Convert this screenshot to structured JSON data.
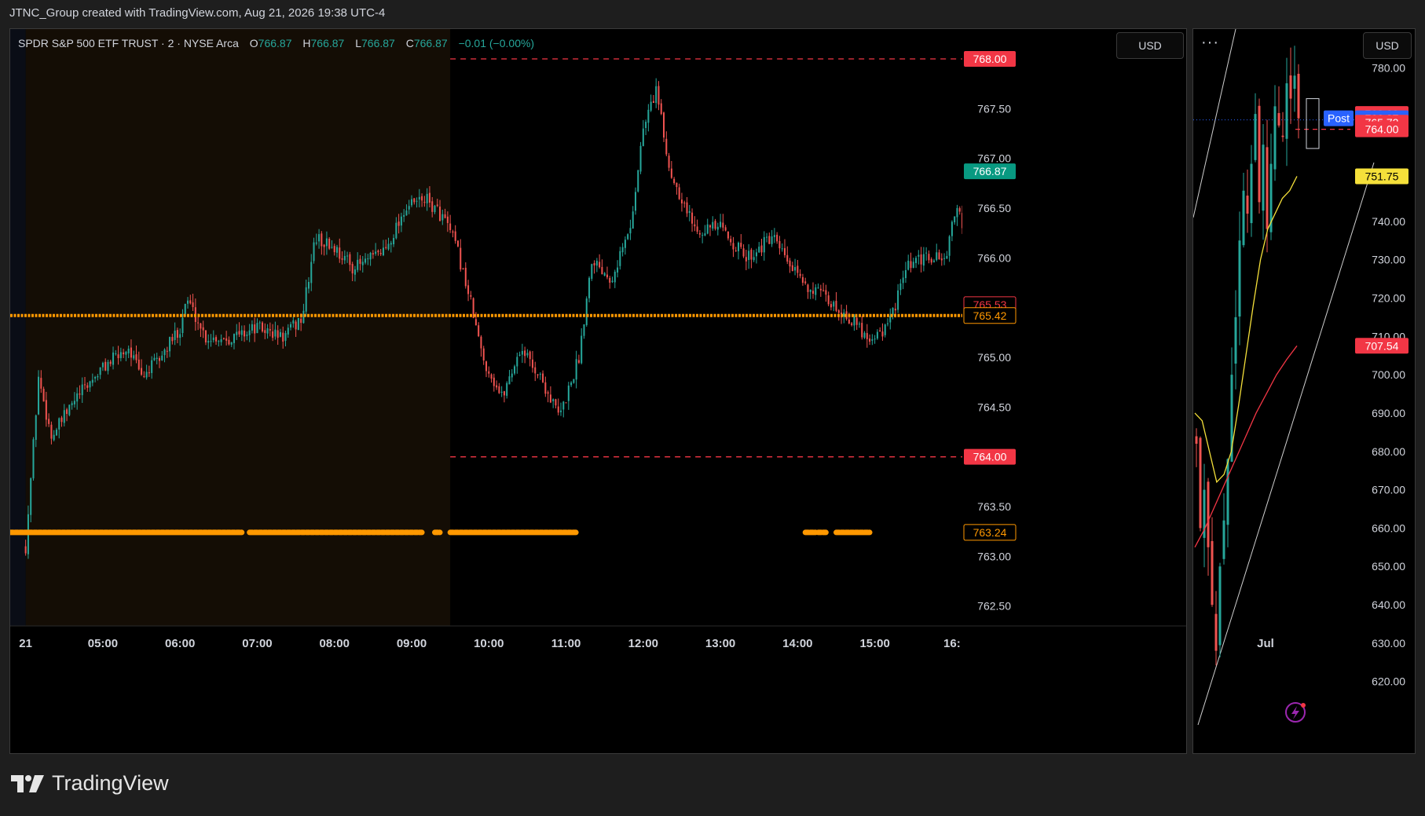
{
  "caption": "JTNC_Group created with TradingView.com, Aug 21, 2026 19:38 UTC-4",
  "brand": "TradingView",
  "main": {
    "currency_button": "USD",
    "legend": {
      "symbol": "SPDR S&P 500 ETF TRUST · 2 · NYSE Arca",
      "open_label": "O",
      "open": "766.87",
      "high_label": "H",
      "high": "766.87",
      "low_label": "L",
      "low": "766.87",
      "close_label": "C",
      "close": "766.87",
      "change": "−0.01 (−0.00%)"
    }
  },
  "mini": {
    "currency_button": "USD",
    "menu_dots": "···"
  },
  "colors": {
    "up": "#26a69a",
    "down": "#ef5350",
    "orange": "#ff9800",
    "premarket_bg": "#140d05",
    "level_red": "#f23645",
    "last_green": "#089981",
    "yellow": "#f5e03a"
  },
  "chart_data": [
    {
      "type": "candlestick",
      "title": "SPDR S&P 500 ETF TRUST · 2 · NYSE Arca",
      "interval": "2 minutes",
      "x_tick_labels": [
        "21",
        "05:00",
        "06:00",
        "07:00",
        "08:00",
        "09:00",
        "10:00",
        "11:00",
        "12:00",
        "13:00",
        "14:00",
        "15:00",
        "16:"
      ],
      "y_tick_labels": [
        "768.00",
        "767.50",
        "767.00",
        "766.50",
        "766.00",
        "765.00",
        "764.50",
        "763.50",
        "763.00",
        "762.50"
      ],
      "ylim": [
        762.3,
        768.3
      ],
      "premarket_shading": {
        "from": "04:00",
        "to": "09:30"
      },
      "price_path": [
        [
          "04:00",
          763.1
        ],
        [
          "04:10",
          764.8
        ],
        [
          "04:20",
          764.2
        ],
        [
          "04:40",
          764.6
        ],
        [
          "05:00",
          764.9
        ],
        [
          "05:20",
          765.1
        ],
        [
          "05:30",
          764.8
        ],
        [
          "05:45",
          765.0
        ],
        [
          "06:00",
          765.3
        ],
        [
          "06:05",
          765.6
        ],
        [
          "06:20",
          765.2
        ],
        [
          "06:40",
          765.2
        ],
        [
          "07:00",
          765.3
        ],
        [
          "07:20",
          765.2
        ],
        [
          "07:35",
          765.4
        ],
        [
          "07:45",
          766.2
        ],
        [
          "08:00",
          766.1
        ],
        [
          "08:15",
          765.9
        ],
        [
          "08:30",
          766.0
        ],
        [
          "08:40",
          766.1
        ],
        [
          "08:55",
          766.5
        ],
        [
          "09:10",
          766.6
        ],
        [
          "09:25",
          766.4
        ],
        [
          "09:35",
          766.1
        ],
        [
          "09:45",
          765.6
        ],
        [
          "09:55",
          765.0
        ],
        [
          "10:10",
          764.6
        ],
        [
          "10:25",
          765.1
        ],
        [
          "10:40",
          764.8
        ],
        [
          "10:55",
          764.4
        ],
        [
          "11:10",
          765.0
        ],
        [
          "11:20",
          766.0
        ],
        [
          "11:35",
          765.8
        ],
        [
          "11:50",
          766.3
        ],
        [
          "12:00",
          767.3
        ],
        [
          "12:10",
          767.7
        ],
        [
          "12:20",
          766.9
        ],
        [
          "12:40",
          766.3
        ],
        [
          "13:00",
          766.3
        ],
        [
          "13:20",
          766.0
        ],
        [
          "13:40",
          766.2
        ],
        [
          "14:00",
          765.8
        ],
        [
          "14:20",
          765.6
        ],
        [
          "14:40",
          765.4
        ],
        [
          "14:55",
          765.2
        ],
        [
          "15:10",
          765.3
        ],
        [
          "15:25",
          765.9
        ],
        [
          "15:40",
          766.0
        ],
        [
          "15:55",
          766.0
        ],
        [
          "16:05",
          766.6
        ],
        [
          "16:15",
          765.6
        ]
      ],
      "lines": {
        "orange_solid": 765.42,
        "red_dashed_upper": 768.0,
        "red_dashed_lower": 764.0,
        "orange_dotted_lower": 763.24
      },
      "price_labels": [
        {
          "value": 768.0,
          "text": "768.00",
          "style": "red"
        },
        {
          "value": 766.87,
          "text": "766.87",
          "style": "green"
        },
        {
          "value": 765.53,
          "text": "765.53",
          "style": "outline-red"
        },
        {
          "value": 765.42,
          "text": "765.42",
          "style": "outline-orange"
        },
        {
          "value": 764.0,
          "text": "764.00",
          "style": "red"
        },
        {
          "value": 763.24,
          "text": "763.24",
          "style": "outline-orange"
        }
      ]
    },
    {
      "type": "candlestick",
      "x_tick_labels": [
        "Jul"
      ],
      "y_tick_labels": [
        "780.00",
        "740.00",
        "730.00",
        "720.00",
        "710.00",
        "700.00",
        "690.00",
        "680.00",
        "670.00",
        "660.00",
        "650.00",
        "640.00",
        "630.00",
        "620.00"
      ],
      "ylim": [
        614,
        784
      ],
      "price_path": [
        682,
        660,
        670,
        655,
        640,
        628,
        650,
        662,
        678,
        700,
        715,
        735,
        748,
        742,
        755,
        768,
        745,
        760,
        738,
        755,
        770,
        765,
        762,
        776,
        772,
        778,
        766.87
      ],
      "yellow_ma": [
        690,
        688,
        680,
        672,
        674,
        680,
        692,
        705,
        718,
        730,
        738,
        742,
        746,
        748,
        751.75
      ],
      "red_ma": [
        655,
        660,
        666,
        672,
        678,
        684,
        690,
        695,
        700,
        704,
        707.54
      ],
      "price_labels": [
        {
          "value": 768.0,
          "text": "768.00",
          "style": "red"
        },
        {
          "value": 766.87,
          "text": "766.87",
          "style": "blue",
          "tag": "Post"
        },
        {
          "value": 765.72,
          "text": "765.72",
          "style": "red"
        },
        {
          "value": 764.0,
          "text": "764.00",
          "style": "red"
        },
        {
          "value": 751.75,
          "text": "751.75",
          "style": "yellow"
        },
        {
          "value": 707.54,
          "text": "707.54",
          "style": "red"
        }
      ]
    }
  ]
}
